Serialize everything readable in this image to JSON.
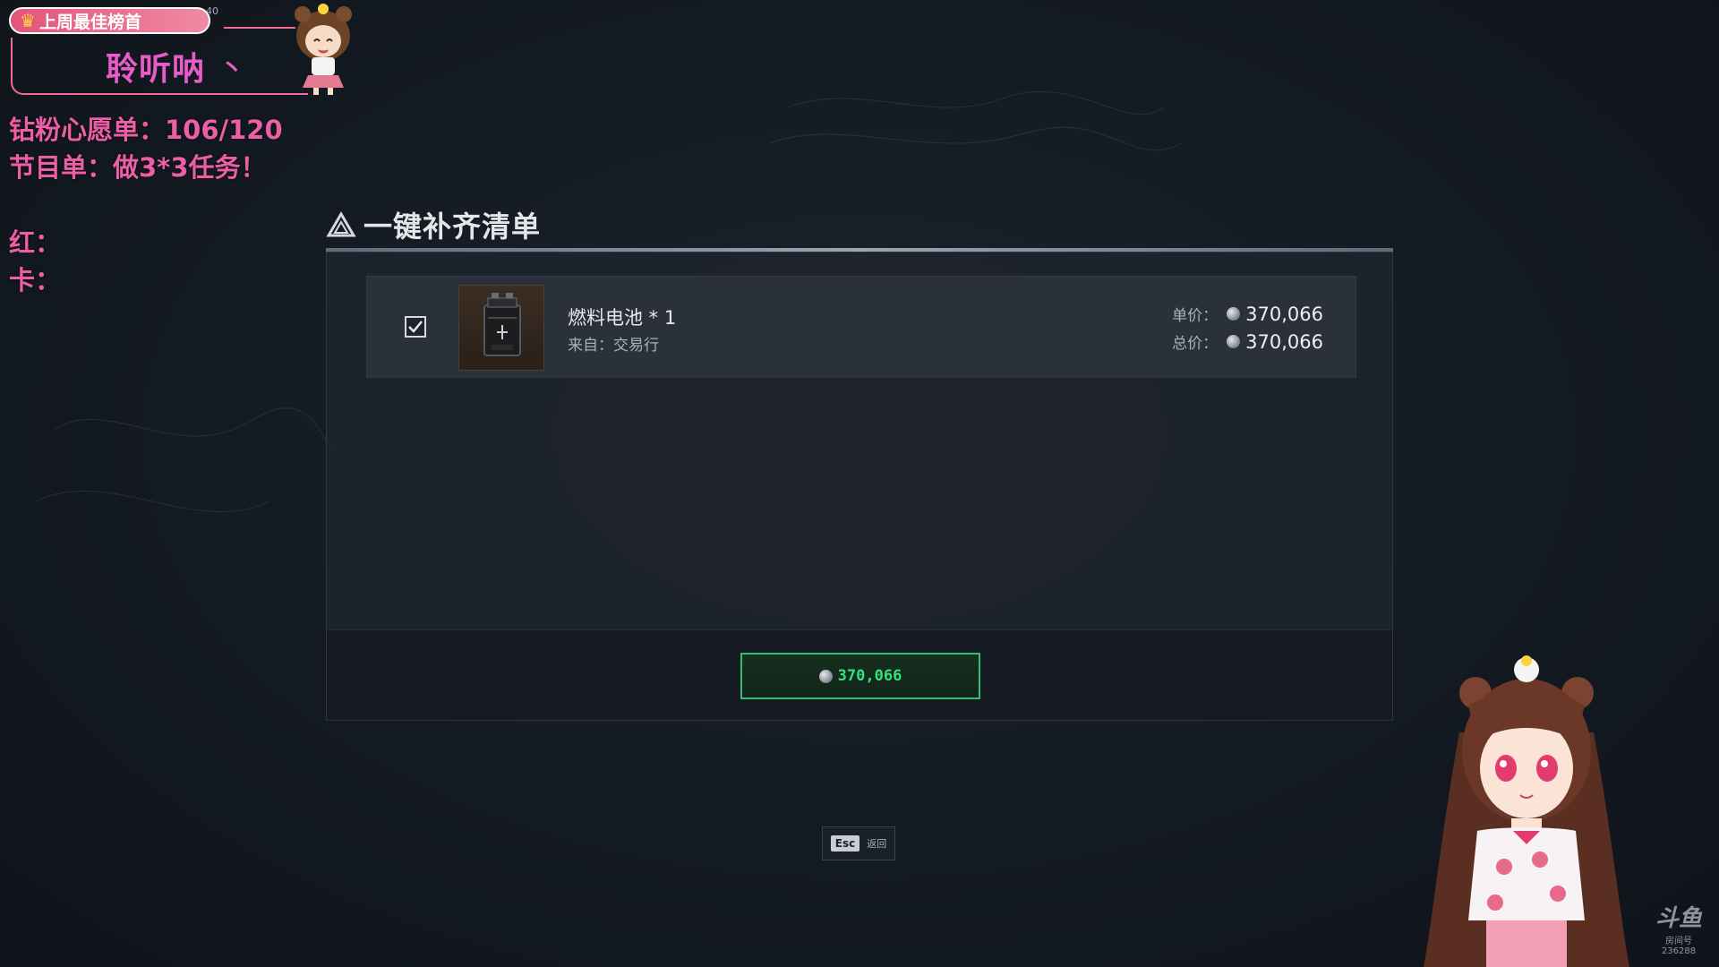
{
  "overlay": {
    "banner_text": "上周最佳榜首",
    "banner_number": "40",
    "streamer_name": "聆听呐",
    "streamer_name_tick": "丶",
    "wishlist_line": "钻粉心愿单：106/120",
    "program_line": "节目单：做3*3任务！",
    "red_line": "红：",
    "card_line": "卡："
  },
  "dialog": {
    "title": "一键补齐清单",
    "item": {
      "checked": true,
      "name": "燃料电池 * 1",
      "source": "来自：交易行",
      "unit_price_label": "单价：",
      "unit_price": "370,066",
      "total_price_label": "总价：",
      "total_price": "370,066"
    },
    "buy_button_value": "370,066"
  },
  "esc_hint": {
    "key": "Esc",
    "label": "返回"
  },
  "watermark": {
    "logo": "斗鱼",
    "room_label": "房间号",
    "room_id": "236288"
  },
  "colors": {
    "accent_green": "#36e07f",
    "overlay_pink": "#ec5fa6",
    "banner_pink": "#e0557a"
  }
}
